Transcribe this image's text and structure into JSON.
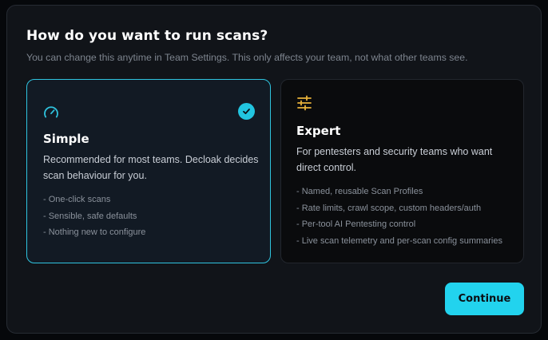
{
  "dialog": {
    "title": "How do you want to run scans?",
    "subtitle": "You can change this anytime in Team Settings. This only affects your team, not what other teams see."
  },
  "options": {
    "simple": {
      "title": "Simple",
      "icon": "gauge-icon",
      "selected": true,
      "description": "Recommended for most teams. Decloak decides scan behaviour for you.",
      "features": [
        "- One-click scans",
        "- Sensible, safe defaults",
        "- Nothing new to configure"
      ]
    },
    "expert": {
      "title": "Expert",
      "icon": "sliders-icon",
      "selected": false,
      "description": "For pentesters and security teams who want direct control.",
      "features": [
        "- Named, reusable Scan Profiles",
        "- Rate limits, crawl scope, custom headers/auth",
        "- Per-tool AI Pentesting control",
        "- Live scan telemetry and per-scan config summaries"
      ]
    }
  },
  "actions": {
    "continue_label": "Continue"
  },
  "colors": {
    "accent": "#22d3ee",
    "selected_border": "#2fc4df",
    "expert_icon": "#e8b23a",
    "dialog_bg": "#111419"
  }
}
